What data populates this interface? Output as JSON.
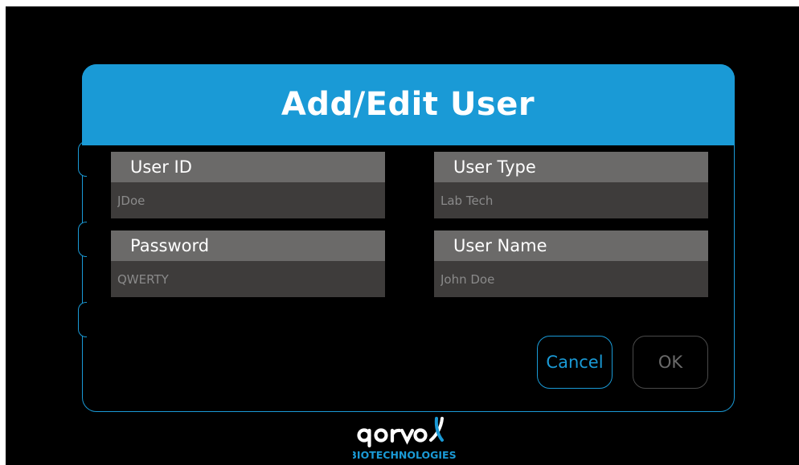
{
  "dialog": {
    "title": "Add/Edit User"
  },
  "fields": {
    "user_id": {
      "label": "User ID",
      "value": "JDoe"
    },
    "user_type": {
      "label": "User Type",
      "value": "Lab Tech"
    },
    "password": {
      "label": "Password",
      "value": "QWERTY"
    },
    "user_name": {
      "label": "User Name",
      "value": "John Doe"
    }
  },
  "buttons": {
    "cancel": "Cancel",
    "ok": "OK"
  },
  "logo": {
    "brand": "qorvo",
    "subtitle": "BIOTECHNOLOGIES"
  },
  "colors": {
    "accent": "#1a9ad6",
    "background": "#000000",
    "label_bg": "#6b6a69",
    "input_bg": "#3e3c3b"
  }
}
